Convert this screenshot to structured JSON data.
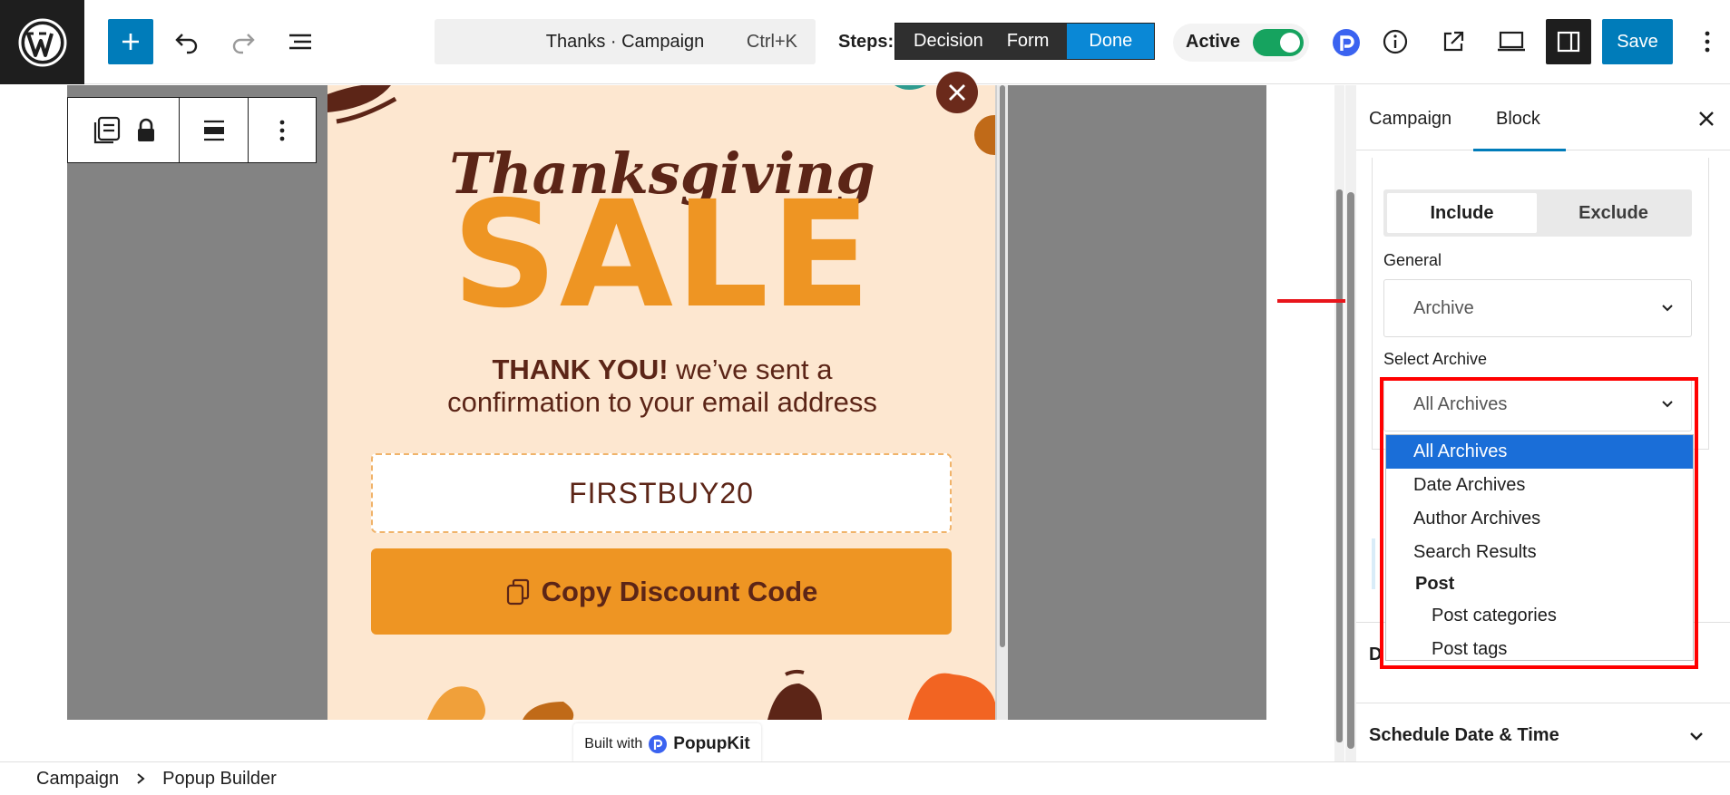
{
  "toolbar": {
    "command_title": "Thanks · Campaign",
    "command_shortcut": "Ctrl+K",
    "steps_label": "Steps:",
    "steps": [
      "Decision",
      "Form",
      "Done"
    ],
    "active_step": "Done",
    "active_label": "Active",
    "active_toggle": true,
    "save_label": "Save",
    "colors": {
      "accent": "#007cba",
      "toggle_on": "#16a35f",
      "step_active": "#0a88d6"
    }
  },
  "popup": {
    "heading_script": "Thanksgiving",
    "heading_big": "SALE",
    "message_bold": "THANK YOU!",
    "message_rest": " we’ve sent a",
    "message_line2": "confirmation to your email address",
    "coupon_code": "FIRSTBUY20",
    "copy_button_label": "Copy Discount Code",
    "built_with_label": "Built with",
    "built_with_brand": "PopupKit",
    "colors": {
      "background": "#fde7d0",
      "orange": "#ee9523",
      "brown": "#5c2517"
    }
  },
  "sidebar": {
    "tabs": [
      "Campaign",
      "Block"
    ],
    "active_tab": "Block",
    "segment": [
      "Include",
      "Exclude"
    ],
    "segment_selected": "Include",
    "general_label": "General",
    "general_value": "Archive",
    "archive_label": "Select Archive",
    "archive_value": "All Archives",
    "archive_options": [
      "All Archives",
      "Date Archives",
      "Author Archives",
      "Search Results"
    ],
    "archive_group": "Post",
    "archive_group_options": [
      "Post categories",
      "Post tags"
    ],
    "hidden_row_fragment": "D",
    "schedule_label": "Schedule Date & Time"
  },
  "breadcrumb": [
    "Campaign",
    "Popup Builder"
  ],
  "icons": [
    "wordpress-logo-icon",
    "plus-icon",
    "undo-icon",
    "redo-icon",
    "list-view-icon",
    "popupkit-icon",
    "info-icon",
    "external-link-icon",
    "preview-device-icon",
    "sidebar-icon",
    "more-vertical-icon",
    "close-icon",
    "chevron-down-icon",
    "copy-icon",
    "lock-icon",
    "align-icon",
    "block-type-icon"
  ]
}
